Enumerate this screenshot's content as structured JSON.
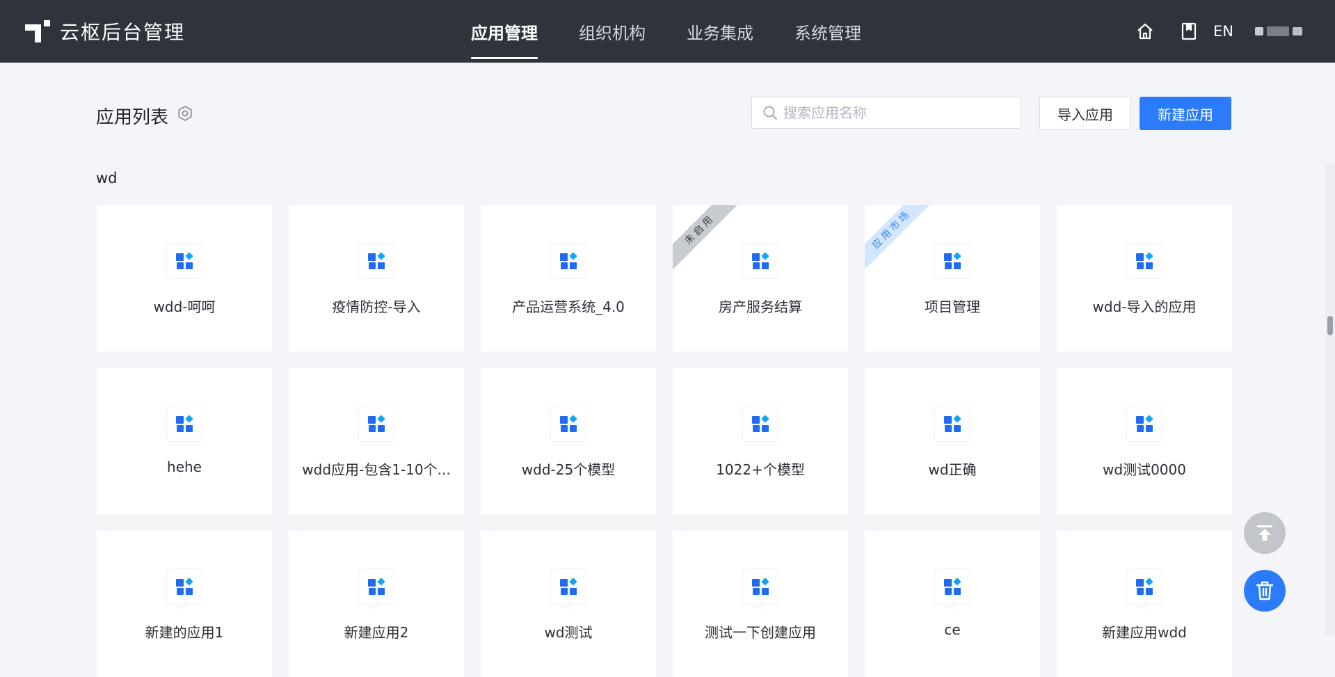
{
  "header": {
    "brand_name": "云枢后台管理",
    "nav": [
      {
        "label": "应用管理",
        "active": true
      },
      {
        "label": "组织机构",
        "active": false
      },
      {
        "label": "业务集成",
        "active": false
      },
      {
        "label": "系统管理",
        "active": false
      }
    ],
    "lang_label": "EN",
    "icons": [
      "home-icon",
      "book-icon"
    ]
  },
  "page": {
    "title": "应用列表",
    "search_placeholder": "搜索应用名称",
    "import_label": "导入应用",
    "new_label": "新建应用",
    "group_title": "wd"
  },
  "apps": [
    {
      "name": "wdd-呵呵"
    },
    {
      "name": "疫情防控-导入"
    },
    {
      "name": "产品运营系统_4.0"
    },
    {
      "name": "房产服务结算",
      "ribbon": "未启用"
    },
    {
      "name": "项目管理",
      "ribbon": "应用市场"
    },
    {
      "name": "wdd-导入的应用"
    },
    {
      "name": "hehe"
    },
    {
      "name": "wdd应用-包含1-10个..."
    },
    {
      "name": "wdd-25个模型"
    },
    {
      "name": "1022+个模型"
    },
    {
      "name": "wd正确"
    },
    {
      "name": "wd测试0000"
    },
    {
      "name": "新建的应用1"
    },
    {
      "name": "新建应用2"
    },
    {
      "name": "wd测试"
    },
    {
      "name": "测试一下创建应用"
    },
    {
      "name": "ce"
    },
    {
      "name": "新建应用wdd"
    }
  ],
  "colors": {
    "header_bg": "#2f333b",
    "primary": "#2b7bfb",
    "page_bg": "#f4f5f8",
    "app_icon": "#1e6cf0",
    "app_icon_accent": "#12a4f5"
  }
}
